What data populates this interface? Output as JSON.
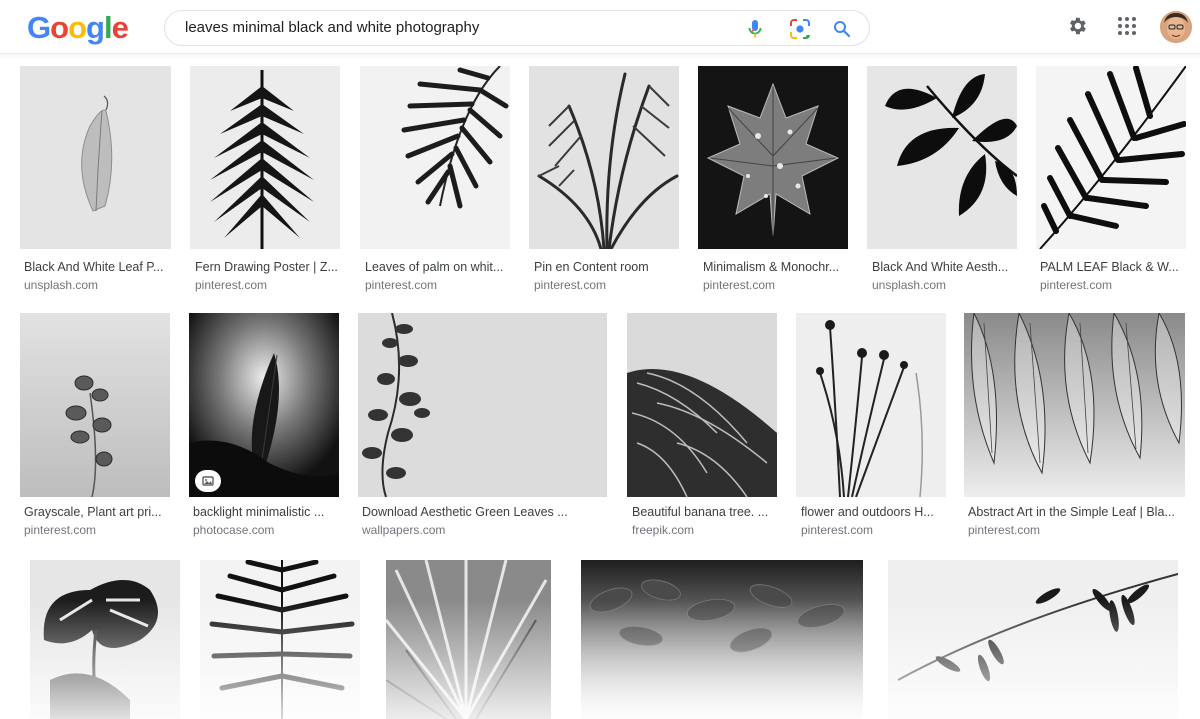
{
  "logo": {
    "letters": [
      "G",
      "o",
      "o",
      "g",
      "l",
      "e"
    ],
    "colors": [
      "#4285F4",
      "#EA4335",
      "#FBBC05",
      "#4285F4",
      "#34A853",
      "#EA4335"
    ]
  },
  "search": {
    "query": "leaves minimal black and white photography"
  },
  "icons": {
    "mic": "microphone-icon",
    "lens": "camera-lens-icon",
    "search": "search-icon",
    "settings": "gear-icon",
    "apps": "apps-grid-icon"
  },
  "results": [
    {
      "title": "Black And White Leaf P...",
      "source": "unsplash.com"
    },
    {
      "title": "Fern Drawing Poster | Z...",
      "source": "pinterest.com"
    },
    {
      "title": "Leaves of palm on whit...",
      "source": "pinterest.com"
    },
    {
      "title": "Pin en Content room",
      "source": "pinterest.com"
    },
    {
      "title": "Minimalism & Monochr...",
      "source": "pinterest.com"
    },
    {
      "title": "Black And White Aesth...",
      "source": "unsplash.com"
    },
    {
      "title": "PALM LEAF Black & W...",
      "source": "pinterest.com"
    },
    {
      "title": "Grayscale, Plant art pri...",
      "source": "pinterest.com"
    },
    {
      "title": "backlight minimalistic ...",
      "source": "photocase.com"
    },
    {
      "title": "Download Aesthetic Green Leaves ...",
      "source": "wallpapers.com"
    },
    {
      "title": "Beautiful banana tree. ...",
      "source": "freepik.com"
    },
    {
      "title": "flower and outdoors H...",
      "source": "pinterest.com"
    },
    {
      "title": "Abstract Art in the Simple Leaf | Bla...",
      "source": "pinterest.com"
    }
  ]
}
